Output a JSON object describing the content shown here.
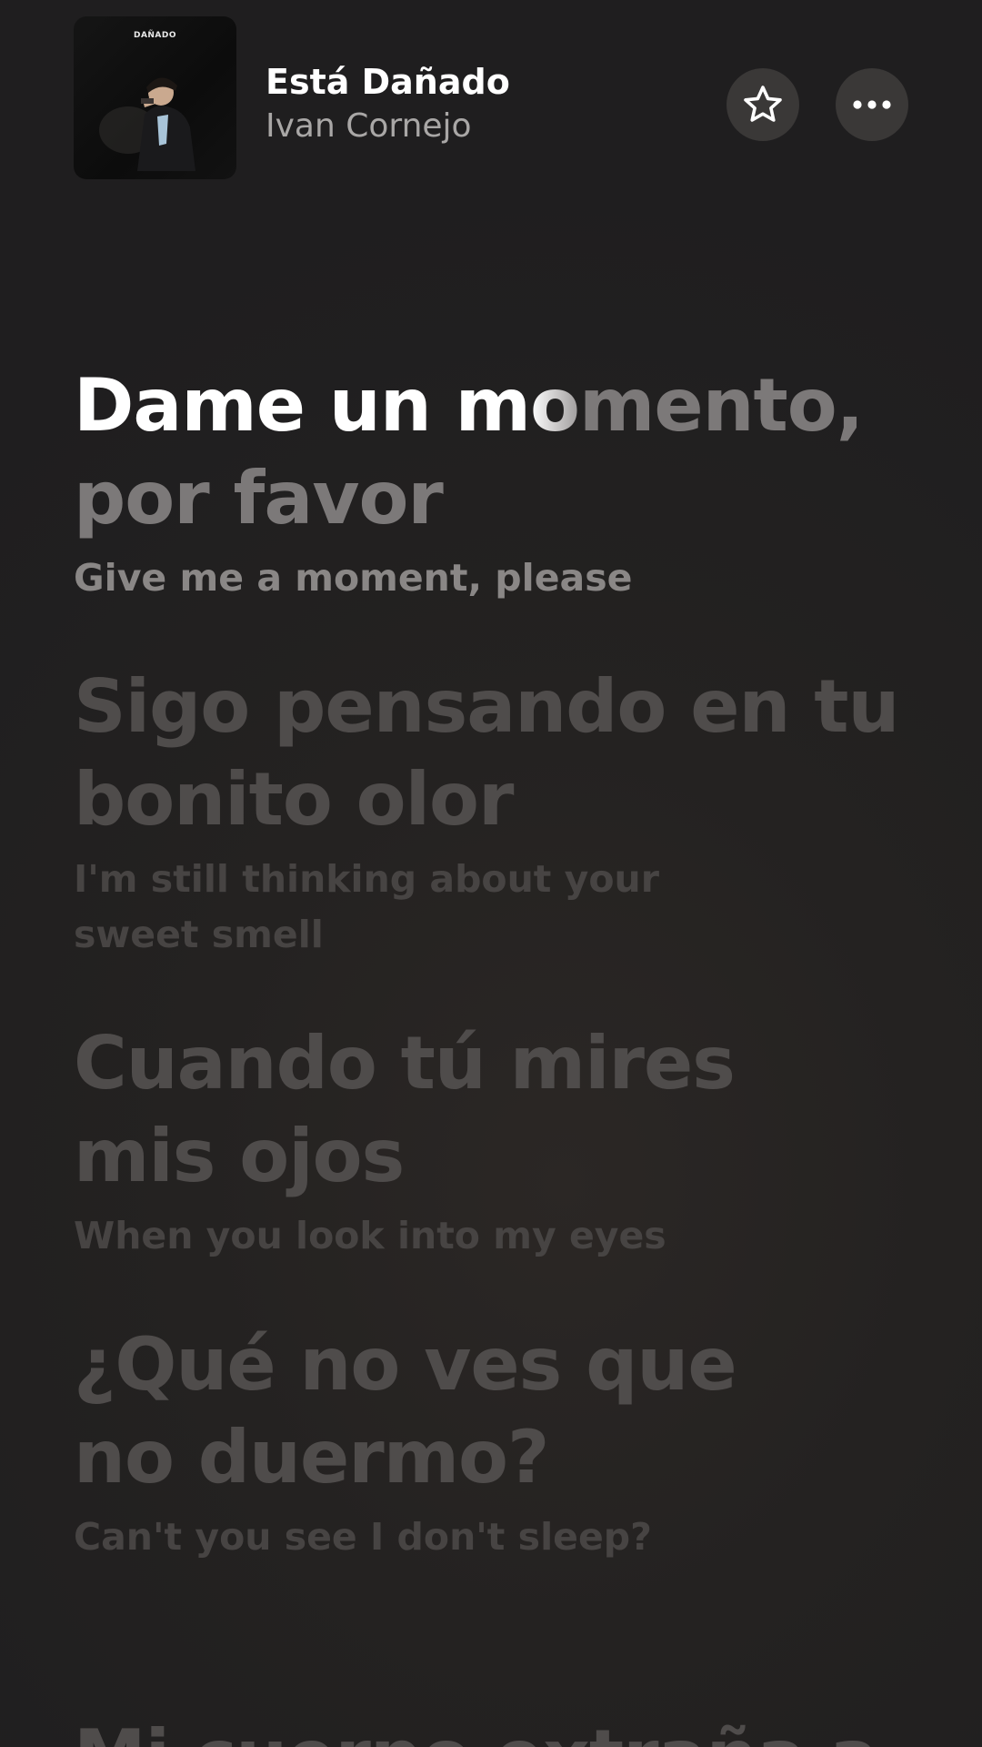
{
  "now_playing": {
    "title": "Está Dañado",
    "artist": "Ivan Cornejo",
    "artwork_text": "DAÑADO"
  },
  "actions": {
    "favorite_icon": "star-icon",
    "more_icon": "ellipsis-icon"
  },
  "lyrics": [
    {
      "sung": "Dame un m",
      "fading": "o",
      "rest": "mento,",
      "line2": "por favor",
      "translation": "Give me a moment, please",
      "active": true
    },
    {
      "line1": "Sigo pensando en tu",
      "line2": "bonito olor",
      "translation_line1": "I'm still thinking about your",
      "translation_line2": "sweet smell"
    },
    {
      "line1": "Cuando tú mires",
      "line2": "mis ojos",
      "translation": "When you look into my eyes"
    },
    {
      "line1": "¿Qué no ves que",
      "line2": "no duermo?",
      "translation": "Can't you see I don't sleep?"
    },
    {
      "line1": "Mi cuerpo extraña a"
    }
  ],
  "colors": {
    "background": "#232121",
    "active_text": "#ffffff",
    "inactive_text": "#4f4c4b",
    "button_bg": "#3a3837"
  }
}
